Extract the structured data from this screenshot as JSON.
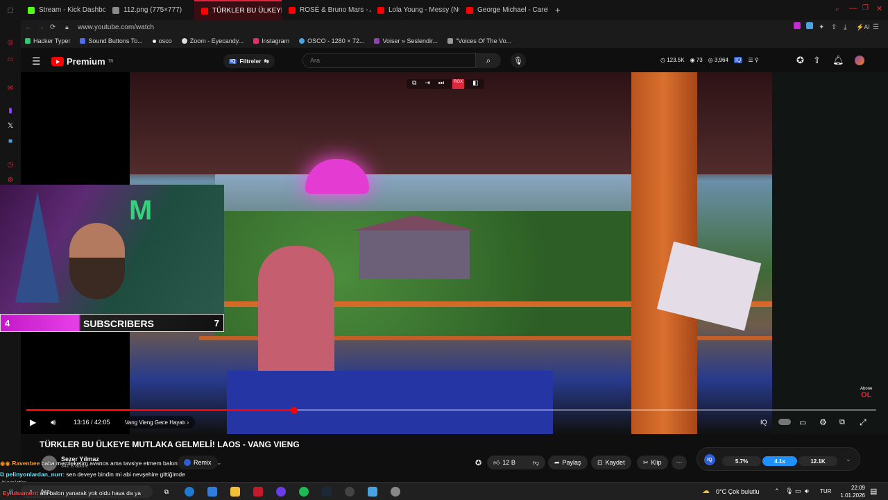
{
  "browser": {
    "tabs": [
      {
        "label": "Stream - Kick Dashboard",
        "color": "#53fc18"
      },
      {
        "label": "112.png (775×777)",
        "color": "#8a8a8a"
      },
      {
        "label": "TÜRKLER BU ÜLKEYE",
        "color": "#ff0000",
        "active": true
      },
      {
        "label": "ROSÉ & Bruno Mars - APT",
        "color": "#ff0000"
      },
      {
        "label": "Lola Young - Messy (NOV",
        "color": "#ff0000"
      },
      {
        "label": "George Michael - Careless",
        "color": "#ff0000"
      }
    ],
    "url": "www.youtube.com/watch",
    "ai_label": "AI",
    "bookmarks": [
      {
        "label": "Hacker Typer",
        "color": "#2ecc71"
      },
      {
        "label": "Sound Buttons To...",
        "color": "#4a6cf7"
      },
      {
        "label": "osco",
        "color": "#eeeeee"
      },
      {
        "label": "Zoom - Eyecandy...",
        "color": "#dddddd"
      },
      {
        "label": "Instagram",
        "color": "#e1306c"
      },
      {
        "label": "OSCO - 1280 × 72...",
        "color": "#4aa3df"
      },
      {
        "label": "Voiser » Seslendir...",
        "color": "#8e44ad"
      },
      {
        "label": "\"Voices Of The Vo...",
        "color": "#999999"
      }
    ]
  },
  "youtube": {
    "logo_text": "Premium",
    "logo_region": "TR",
    "filters_label": "Filtreler",
    "search_placeholder": "Ara",
    "header_stats": {
      "views": "123.5K",
      "count": "73",
      "eye": "3,964"
    }
  },
  "video": {
    "subscriber_overlay": {
      "left": "4",
      "label": "SUBSCRIBERS",
      "right": "7"
    },
    "corner_badge": {
      "top": "Abone",
      "bottom": "OL"
    },
    "current_time": "13:16",
    "duration": "42:05",
    "time_display": "13:16 / 42:05",
    "chapter": "Vang Vieng Gece Hayatı",
    "progress_fraction": 0.3153,
    "title": "TÜRKLER BU ÜLKEYE MUTLAKA GELMELİ! LAOS - VANG VIENG"
  },
  "channel": {
    "name": "Sezer Yılmaz",
    "subscribers": "341 B abone",
    "remix_label": "Remix"
  },
  "actions": {
    "likes": "12 B",
    "share": "Paylaş",
    "save": "Kaydet",
    "clip": "Klip"
  },
  "stats_panel": {
    "a": "5.7%",
    "b": "4.1x",
    "c": "12.1K"
  },
  "chat": [
    {
      "user": "Ravenbee",
      "text": "baba memleketim avanos ama tavsiye etmem balon",
      "color": "#ff9b2f"
    },
    {
      "user": "pelinyonlardan_nurr",
      "text": ": sen deveye bindin mi abi nevşehire gittiğimde",
      "color": "#6ee7ff"
    },
    {
      "user": "",
      "text": "binmiştim",
      "color": "#ffffff"
    },
    {
      "user": "Eylulsumerr",
      "text": ": abi balon yanarak yok oldu hava da ya",
      "color": "#ff4d4d"
    }
  ],
  "taskbar": {
    "search_label": "Ara",
    "weather": "0°C  Çok bulutlu",
    "lang": "TUR",
    "time": "22:09",
    "date": "1.01.2026"
  }
}
